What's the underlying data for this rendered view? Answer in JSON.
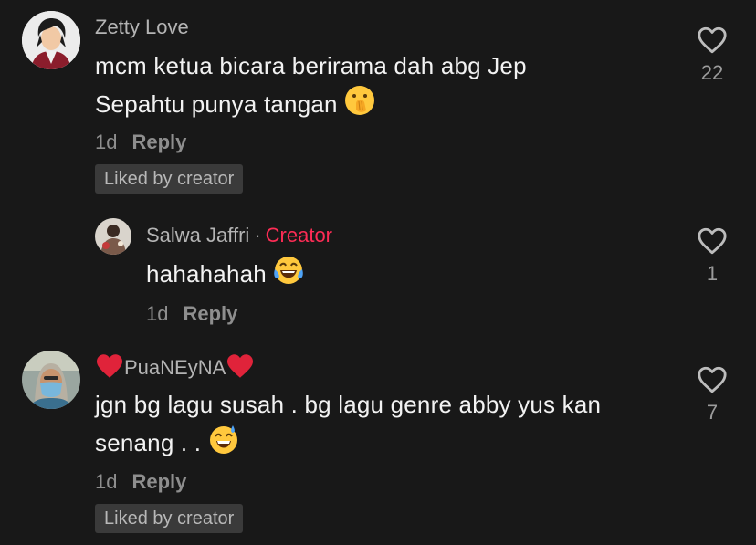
{
  "comments": [
    {
      "username": "Zetty Love",
      "text_line1": "mcm ketua bicara berirama dah abg Jep",
      "text_line2": "Sepahtu punya tangan",
      "emoji": "hand-over-mouth-emoji",
      "time": "1d",
      "reply_label": "Reply",
      "liked_badge": "Liked by creator",
      "like_count": "22"
    },
    {
      "username": "Salwa Jaffri",
      "separator": "·",
      "creator_label": "Creator",
      "text": "hahahahah",
      "emoji": "tears-of-joy-emoji",
      "time": "1d",
      "reply_label": "Reply",
      "like_count": "1"
    },
    {
      "username": "PuaNEyNA",
      "username_decoration": "red-heart-icon",
      "text_line1": "jgn bg lagu susah . bg lagu genre abby yus kan",
      "text_line2": "senang . .",
      "emoji": "grinning-sweat-emoji",
      "time": "1d",
      "reply_label": "Reply",
      "liked_badge": "Liked by creator",
      "like_count": "7"
    }
  ],
  "colors": {
    "background": "#181818",
    "creator_accent": "#fe2c55",
    "badge_bg": "#3a3a3a"
  }
}
